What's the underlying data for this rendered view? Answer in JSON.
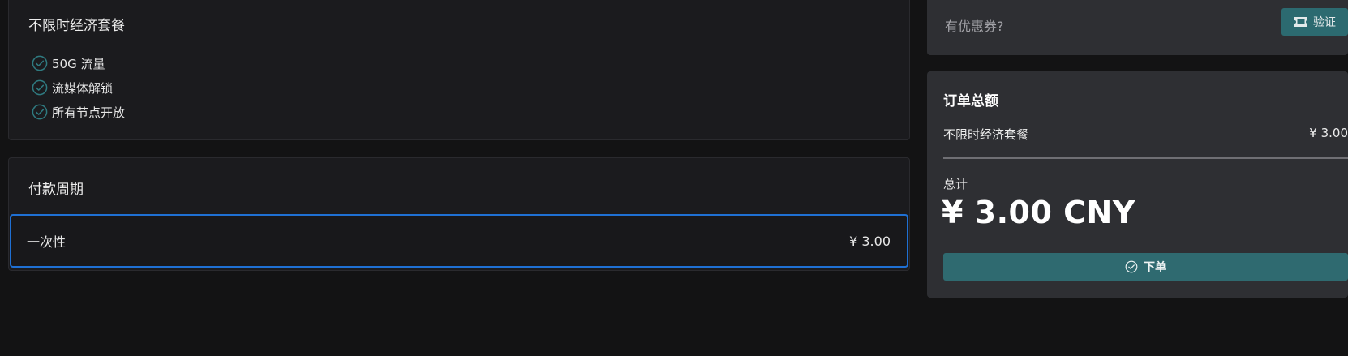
{
  "plan": {
    "title": "不限时经济套餐",
    "features": [
      {
        "label": "50G 流量",
        "icon": "check-circle-icon"
      },
      {
        "label": "流媒体解锁",
        "icon": "check-circle-icon"
      },
      {
        "label": "所有节点开放",
        "icon": "check-circle-icon"
      }
    ]
  },
  "period": {
    "title": "付款周期",
    "option": {
      "label": "一次性",
      "price": "¥ 3.00",
      "selected": true
    }
  },
  "coupon": {
    "placeholder": "有优惠券?",
    "verify_label": "验证",
    "verify_icon": "ticket-icon"
  },
  "summary": {
    "title": "订单总额",
    "item_name": "不限时经济套餐",
    "item_price": "¥ 3.00",
    "total_label": "总计",
    "total_amount": "¥ 3.00 CNY",
    "order_label": "下单",
    "order_icon": "check-circle-icon"
  },
  "colors": {
    "accent_teal": "#2f6a70",
    "selection_blue": "#1f70d4",
    "check_icon": "#2f7a80"
  }
}
